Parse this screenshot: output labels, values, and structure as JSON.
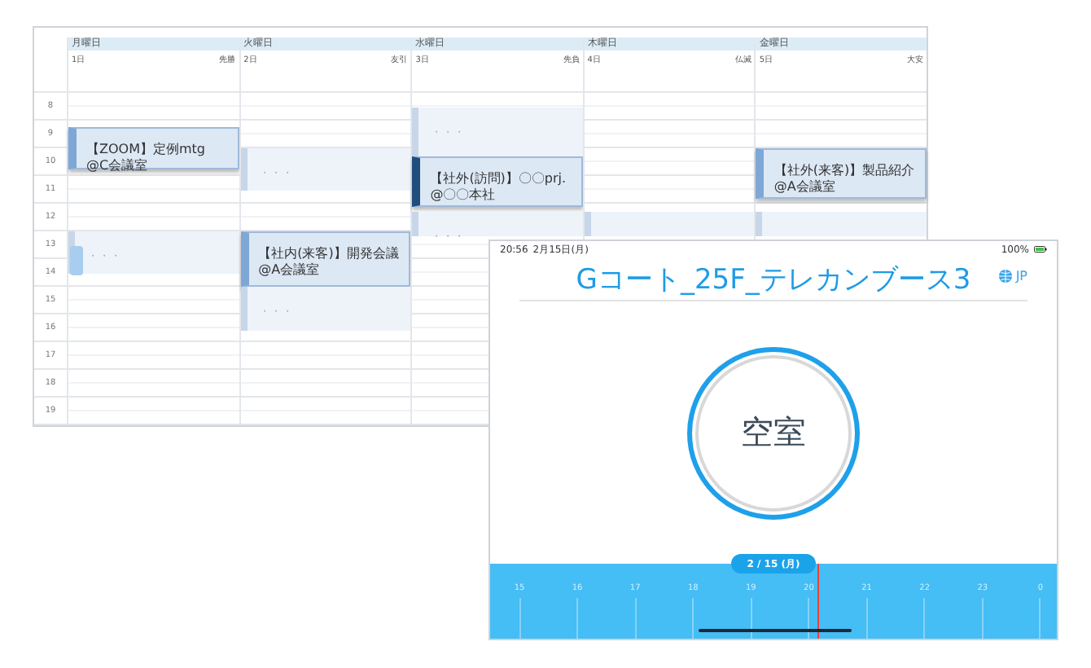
{
  "calendar": {
    "hours": [
      "8",
      "9",
      "10",
      "11",
      "12",
      "13",
      "14",
      "15",
      "16",
      "17",
      "18",
      "19"
    ],
    "days": [
      {
        "weekday": "月曜日",
        "date": "1日",
        "rokuyo": "先勝",
        "events": [
          {
            "kind": "event",
            "title": "【ZOOM】定例mtg",
            "location": "@C会議室",
            "selected": false
          },
          {
            "kind": "placeholder",
            "text": "・・・"
          },
          {
            "kind": "mini"
          }
        ]
      },
      {
        "weekday": "火曜日",
        "date": "2日",
        "rokuyo": "友引",
        "events": [
          {
            "kind": "placeholder",
            "text": "・・・"
          },
          {
            "kind": "event",
            "title": "【社内(来客)】開発会議",
            "location": "@A会議室",
            "selected": false
          },
          {
            "kind": "placeholder",
            "text": "・・・"
          }
        ]
      },
      {
        "weekday": "水曜日",
        "date": "3日",
        "rokuyo": "先負",
        "events": [
          {
            "kind": "placeholder",
            "text": "・・・"
          },
          {
            "kind": "event",
            "title": "【社外(訪問)】〇〇prj.",
            "location": "@〇〇本社",
            "selected": true
          },
          {
            "kind": "placeholder",
            "text": "・・・"
          }
        ]
      },
      {
        "weekday": "木曜日",
        "date": "4日",
        "rokuyo": "仏滅",
        "events": [
          {
            "kind": "block"
          }
        ]
      },
      {
        "weekday": "金曜日",
        "date": "5日",
        "rokuyo": "大安",
        "events": [
          {
            "kind": "event",
            "title": "【社外(来客)】製品紹介",
            "location": "@A会議室",
            "selected": false
          },
          {
            "kind": "block"
          }
        ]
      }
    ]
  },
  "room_display": {
    "status_bar": {
      "time": "20:56",
      "date": "2月15日(月)",
      "battery": "100%"
    },
    "room_name": "Gコート_25F_テレカンブース3",
    "language": "JP",
    "status": "空室",
    "timeline": {
      "date": "2 / 15 (月)",
      "hours": [
        "15",
        "16",
        "17",
        "18",
        "19",
        "20",
        "21",
        "22",
        "23",
        "0"
      ],
      "now_marker": {
        "level": 0.574
      }
    }
  }
}
